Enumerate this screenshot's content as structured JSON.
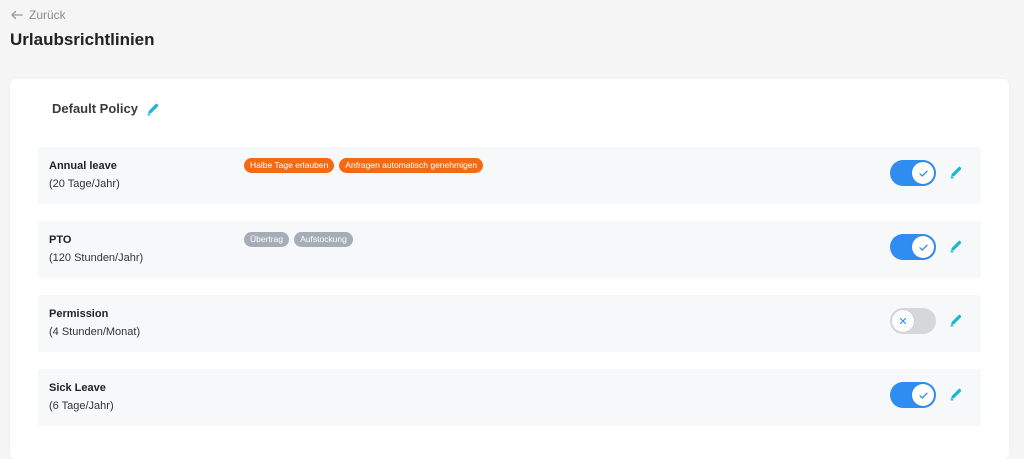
{
  "nav": {
    "back_label": "Zurück"
  },
  "page": {
    "title": "Urlaubsrichtlinien"
  },
  "policy": {
    "name": "Default Policy"
  },
  "colors": {
    "accent_teal": "#19b7d3",
    "toggle_on": "#2f8cf0",
    "toggle_off": "#d6d7d9",
    "tag_orange": "#f36a12",
    "tag_gray": "#a4adb8"
  },
  "rows": [
    {
      "name": "Annual leave",
      "allowance": "(20 Tage/Jahr)",
      "tags": [
        "Halbe Tage erlauben",
        "Anfragen automatisch genehmigen"
      ],
      "enabled": true
    },
    {
      "name": "PTO",
      "allowance": "(120 Stunden/Jahr)",
      "tags": [
        "Übertrag",
        "Aufstockung"
      ],
      "enabled": true
    },
    {
      "name": "Permission",
      "allowance": "(4 Stunden/Monat)",
      "tags": [],
      "enabled": false
    },
    {
      "name": "Sick Leave",
      "allowance": "(6 Tage/Jahr)",
      "tags": [],
      "enabled": true
    }
  ]
}
